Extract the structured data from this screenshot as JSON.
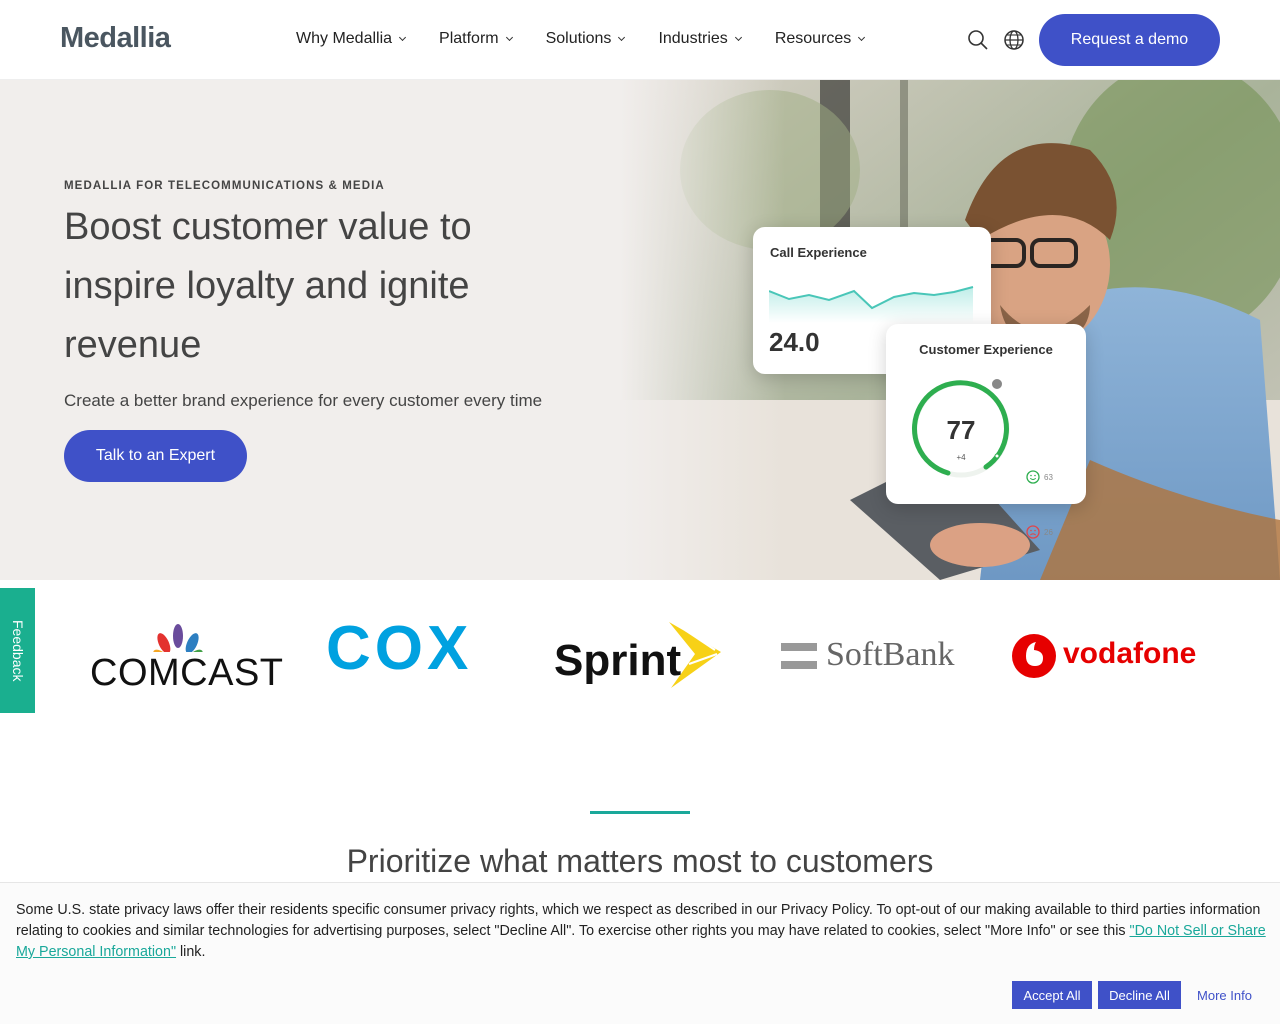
{
  "header": {
    "logo": "Medallia",
    "nav": [
      {
        "label": "Why Medallia"
      },
      {
        "label": "Platform"
      },
      {
        "label": "Solutions"
      },
      {
        "label": "Industries"
      },
      {
        "label": "Resources"
      }
    ],
    "cta": "Request a demo",
    "icons": [
      "search-icon",
      "globe-icon"
    ]
  },
  "hero": {
    "eyebrow": "MEDALLIA FOR TELECOMMUNICATIONS & MEDIA",
    "title": "Boost customer value to inspire loyalty and ignite revenue",
    "subtitle": "Create a better brand experience for every customer every time",
    "cta": "Talk to an Expert",
    "call_card": {
      "title": "Call Experience",
      "value": "24.0"
    },
    "cx_card": {
      "title": "Customer Experience",
      "score": "77",
      "delta": "+4",
      "positive": "63",
      "negative": "26"
    }
  },
  "logos": [
    "COMCAST",
    "COX",
    "Sprint",
    "SoftBank",
    "vodafone"
  ],
  "feedback": "Feedback",
  "section": {
    "title": "Prioritize what matters most to customers"
  },
  "cookie": {
    "text_before": "Some U.S. state privacy laws offer their residents specific consumer privacy rights, which we respect as described in our Privacy Policy. To opt-out of our making available to third parties information relating to cookies and similar technologies for advertising purposes, select \"Decline All\". To exercise other rights you may have related to cookies, select \"More Info\" or see this ",
    "link": "\"Do Not Sell or Share My Personal Information\"",
    "text_after": " link.",
    "accept": "Accept All",
    "decline": "Decline All",
    "more": "More Info"
  },
  "colors": {
    "accent": "#3f51c8",
    "teal": "#1aa89a",
    "feedback": "#1aaf8f"
  }
}
